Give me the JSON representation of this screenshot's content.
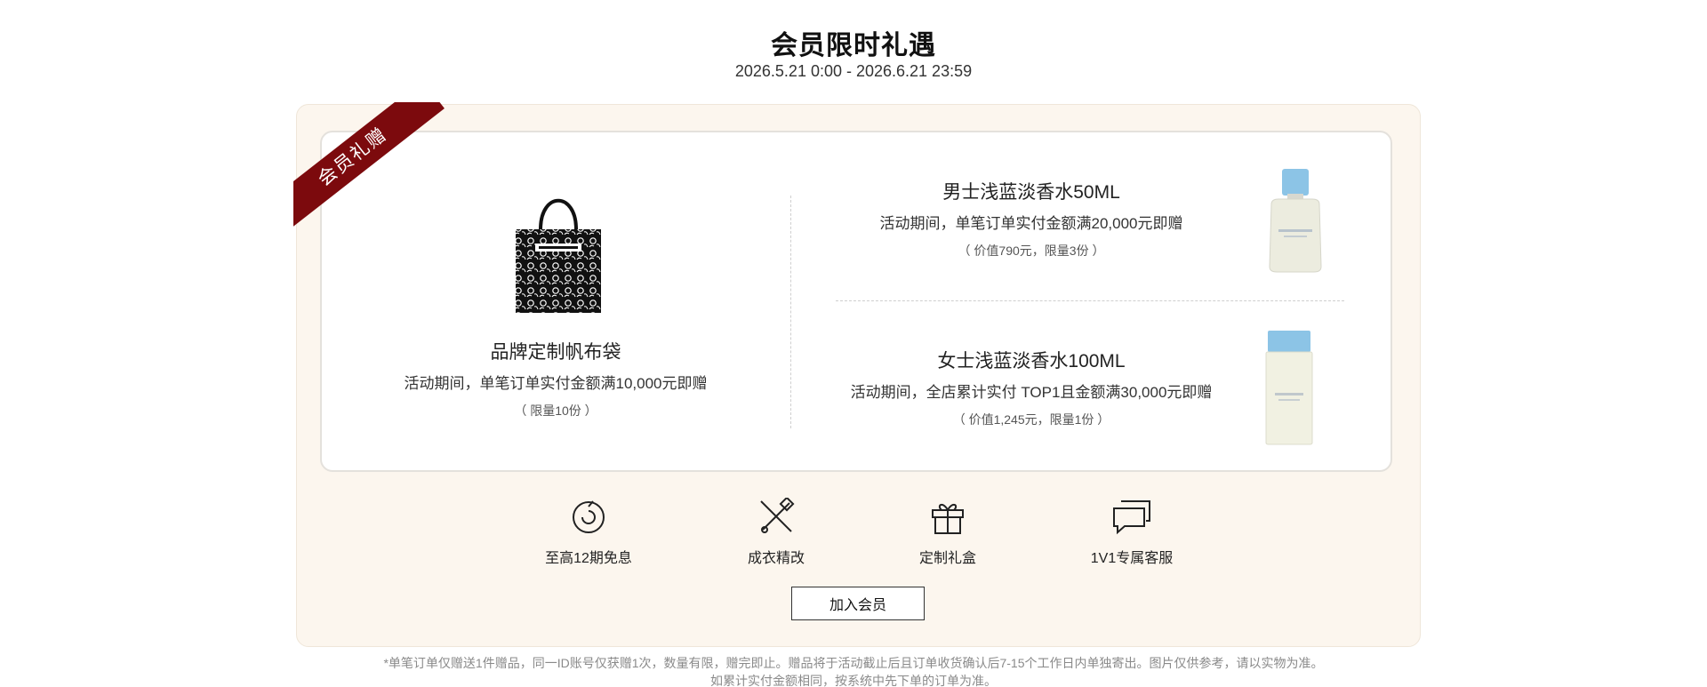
{
  "header": {
    "title": "会员限时礼遇",
    "period": "2026.5.21 0:00 - 2026.6.21 23:59"
  },
  "ribbon": {
    "label": "会员礼赠"
  },
  "gifts": [
    {
      "name": "品牌定制帆布袋",
      "desc": "活动期间，单笔订单实付金额满10,000元即赠",
      "note": "（ 限量10份 ）",
      "image": "tote-bag-icon"
    },
    {
      "name": "男士浅蓝淡香水50ML",
      "desc": "活动期间，单笔订单实付金额满20,000元即赠",
      "note": "（ 价值790元，限量3份 ）",
      "image": "perfume-bottle-men-icon"
    },
    {
      "name": "女士浅蓝淡香水100ML",
      "desc": "活动期间，全店累计实付 TOP1且金额满30,000元即赠",
      "note": "（ 价值1,245元，限量1份 ）",
      "image": "perfume-bottle-women-icon"
    }
  ],
  "perks": [
    {
      "label": "至高12期免息",
      "icon": "installment-icon"
    },
    {
      "label": "成衣精改",
      "icon": "tailoring-icon"
    },
    {
      "label": "定制礼盒",
      "icon": "gift-box-icon"
    },
    {
      "label": "1V1专属客服",
      "icon": "chat-icon"
    }
  ],
  "cta": {
    "join_label": "加入会员"
  },
  "footnote": {
    "line1": "*单笔订单仅赠送1件赠品，同一ID账号仅获赠1次，数量有限，赠完即止。赠品将于活动截止后且订单收货确认后7-15个工作日内单独寄出。图片仅供参考，请以实物为准。",
    "line2": "如累计实付金额相同，按系统中先下单的订单为准。"
  },
  "colors": {
    "ribbon": "#7c0a0d",
    "panel_bg": "#fcf6ee",
    "bottle_cap": "#8cc4e6"
  }
}
